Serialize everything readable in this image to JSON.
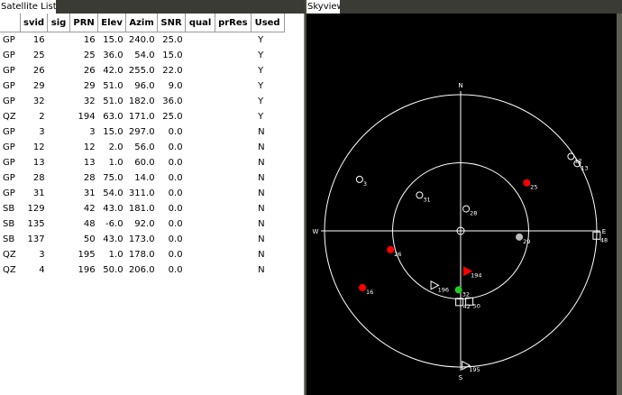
{
  "window": {
    "list_title": "Satellite List",
    "sky_title": "Skyview"
  },
  "table": {
    "columns": [
      "",
      "svid",
      "sig",
      "PRN",
      "Elev",
      "Azim",
      "SNR",
      "qual",
      "prRes",
      "Used"
    ],
    "rows": [
      [
        "GP",
        "16",
        "",
        "16",
        "15.0",
        "240.0",
        "25.0",
        "",
        "",
        "Y"
      ],
      [
        "GP",
        "25",
        "",
        "25",
        "36.0",
        "54.0",
        "15.0",
        "",
        "",
        "Y"
      ],
      [
        "GP",
        "26",
        "",
        "26",
        "42.0",
        "255.0",
        "22.0",
        "",
        "",
        "Y"
      ],
      [
        "GP",
        "29",
        "",
        "29",
        "51.0",
        "96.0",
        "9.0",
        "",
        "",
        "Y"
      ],
      [
        "GP",
        "32",
        "",
        "32",
        "51.0",
        "182.0",
        "36.0",
        "",
        "",
        "Y"
      ],
      [
        "QZ",
        "2",
        "",
        "194",
        "63.0",
        "171.0",
        "25.0",
        "",
        "",
        "Y"
      ],
      [
        "GP",
        "3",
        "",
        "3",
        "15.0",
        "297.0",
        "0.0",
        "",
        "",
        "N"
      ],
      [
        "GP",
        "12",
        "",
        "12",
        "2.0",
        "56.0",
        "0.0",
        "",
        "",
        "N"
      ],
      [
        "GP",
        "13",
        "",
        "13",
        "1.0",
        "60.0",
        "0.0",
        "",
        "",
        "N"
      ],
      [
        "GP",
        "28",
        "",
        "28",
        "75.0",
        "14.0",
        "0.0",
        "",
        "",
        "N"
      ],
      [
        "GP",
        "31",
        "",
        "31",
        "54.0",
        "311.0",
        "0.0",
        "",
        "",
        "N"
      ],
      [
        "SB",
        "129",
        "",
        "42",
        "43.0",
        "181.0",
        "0.0",
        "",
        "",
        "N"
      ],
      [
        "SB",
        "135",
        "",
        "48",
        "-6.0",
        "92.0",
        "0.0",
        "",
        "",
        "N"
      ],
      [
        "SB",
        "137",
        "",
        "50",
        "43.0",
        "173.0",
        "0.0",
        "",
        "",
        "N"
      ],
      [
        "QZ",
        "3",
        "",
        "195",
        "1.0",
        "178.0",
        "0.0",
        "",
        "",
        "N"
      ],
      [
        "QZ",
        "4",
        "",
        "196",
        "50.0",
        "206.0",
        "0.0",
        "",
        "",
        "N"
      ]
    ]
  },
  "skyview": {
    "compass": {
      "north": "N",
      "south": "S",
      "west": "W",
      "east": "E"
    },
    "satellites": [
      {
        "label": "16",
        "el": 15,
        "az": 240,
        "shape": "circle",
        "color": "#ff0000",
        "filled": true
      },
      {
        "label": "25",
        "el": 36,
        "az": 54,
        "shape": "circle",
        "color": "#ff0000",
        "filled": true
      },
      {
        "label": "26",
        "el": 42,
        "az": 255,
        "shape": "circle",
        "color": "#ff0000",
        "filled": true
      },
      {
        "label": "29",
        "el": 51,
        "az": 96,
        "shape": "circle",
        "color": "#bbbbbb",
        "filled": true
      },
      {
        "label": "32",
        "el": 51,
        "az": 182,
        "shape": "circle",
        "color": "#22cc22",
        "filled": true
      },
      {
        "label": "194",
        "el": 63,
        "az": 171,
        "shape": "triangle",
        "color": "#ff0000",
        "filled": true
      },
      {
        "label": "3",
        "el": 15,
        "az": 297,
        "shape": "circle",
        "color": "#ffffff",
        "filled": false
      },
      {
        "label": "12",
        "el": 2,
        "az": 56,
        "shape": "circle",
        "color": "#ffffff",
        "filled": false
      },
      {
        "label": "13",
        "el": 1,
        "az": 60,
        "shape": "circle",
        "color": "#ffffff",
        "filled": false
      },
      {
        "label": "28",
        "el": 75,
        "az": 14,
        "shape": "circle",
        "color": "#ffffff",
        "filled": false
      },
      {
        "label": "31",
        "el": 54,
        "az": 311,
        "shape": "circle",
        "color": "#ffffff",
        "filled": false
      },
      {
        "label": "42",
        "el": 43,
        "az": 181,
        "shape": "square",
        "color": "#ffffff",
        "filled": false
      },
      {
        "label": "48",
        "el": 0,
        "az": 92,
        "shape": "square",
        "color": "#ffffff",
        "filled": false
      },
      {
        "label": "50",
        "el": 43,
        "az": 173,
        "shape": "square",
        "color": "#ffffff",
        "filled": false
      },
      {
        "label": "195",
        "el": 1,
        "az": 178,
        "shape": "triangle",
        "color": "#ffffff",
        "filled": false
      },
      {
        "label": "196",
        "el": 50,
        "az": 206,
        "shape": "triangle",
        "color": "#ffffff",
        "filled": false
      }
    ]
  }
}
